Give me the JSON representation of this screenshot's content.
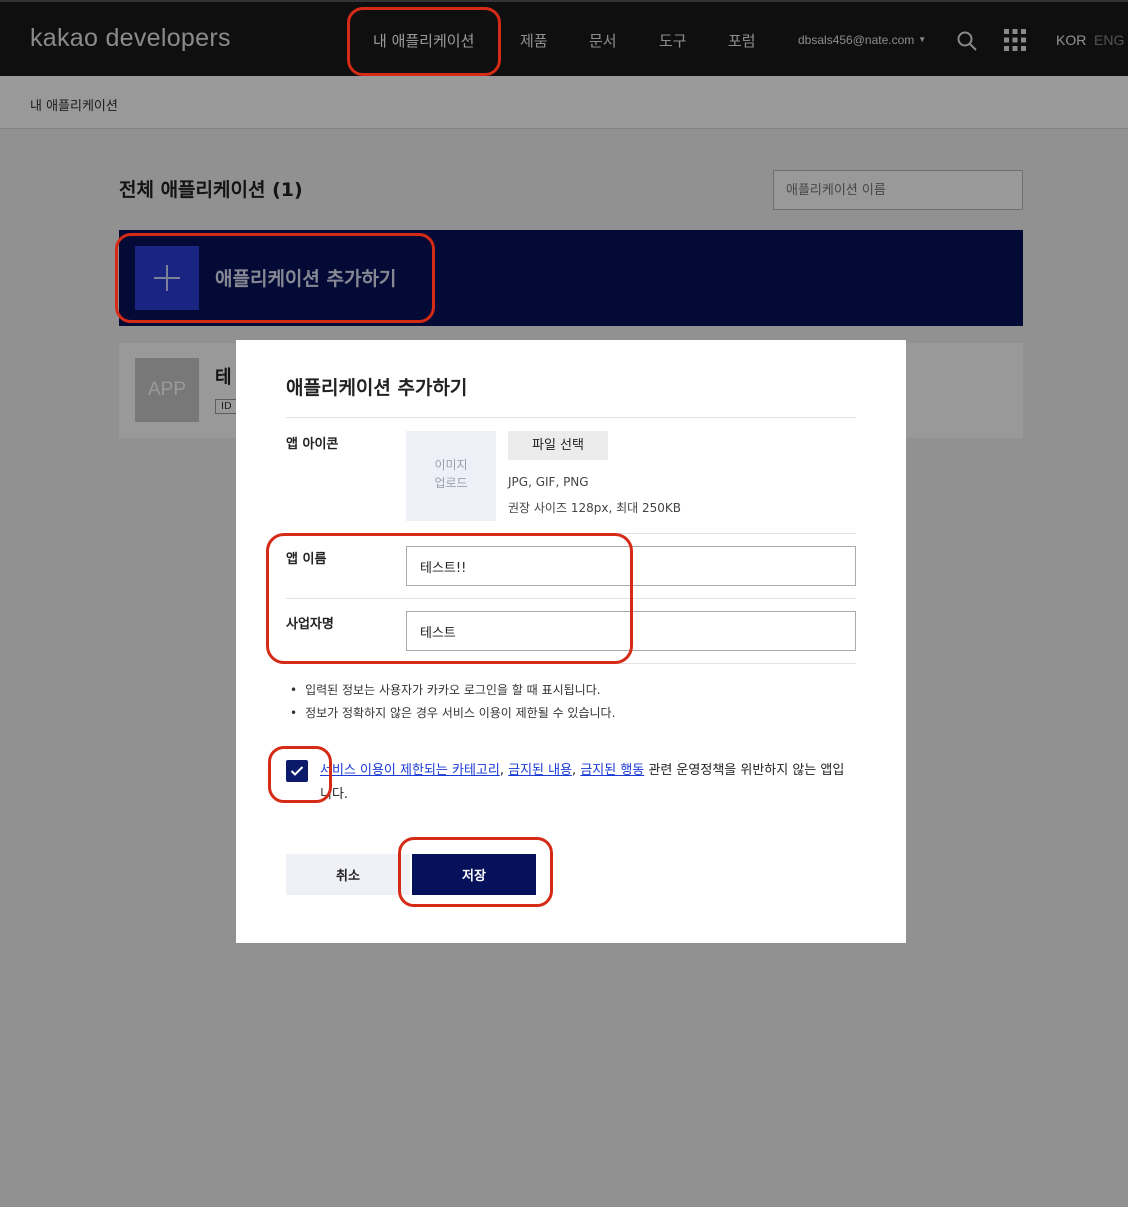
{
  "header": {
    "logo": "kakao developers",
    "nav": [
      "내 애플리케이션",
      "제품",
      "문서",
      "도구",
      "포럼"
    ],
    "user_email": "dbsals456@nate.com",
    "lang_kor": "KOR",
    "lang_eng": "ENG"
  },
  "breadcrumb": "내 애플리케이션",
  "main": {
    "title": "전체 애플리케이션 (1)",
    "search_placeholder": "애플리케이션 이름",
    "add_label": "애플리케이션 추가하기",
    "app_card": {
      "thumb": "APP",
      "name": "테",
      "id_badge": "ID"
    }
  },
  "modal": {
    "title": "애플리케이션 추가하기",
    "icon_label": "앱 아이콘",
    "upload_line1": "이미지",
    "upload_line2": "업로드",
    "file_button": "파일 선택",
    "file_formats": "JPG, GIF, PNG",
    "file_size_hint": "권장 사이즈 128px, 최대 250KB",
    "name_label": "앱 이름",
    "name_value": "테스트!!",
    "company_label": "사업자명",
    "company_value": "테스트",
    "notes": [
      "입력된 정보는 사용자가 카카오 로그인을 할 때 표시됩니다.",
      "정보가 정확하지 않은 경우 서비스 이용이 제한될 수 있습니다."
    ],
    "agree": {
      "link1": "서비스 이용이 제한되는 카테고리",
      "sep1": ", ",
      "link2": "금지된 내용",
      "sep2": ", ",
      "link3": "금지된 행동",
      "rest": " 관련 운영정책을 위반하지 않는 앱입니다."
    },
    "cancel": "취소",
    "save": "저장"
  },
  "colors": {
    "header_bg": "#1a1a1a",
    "brand_navy": "#05115a",
    "accent_blue": "#2b3ed6",
    "annotation_red": "#d52b16"
  }
}
